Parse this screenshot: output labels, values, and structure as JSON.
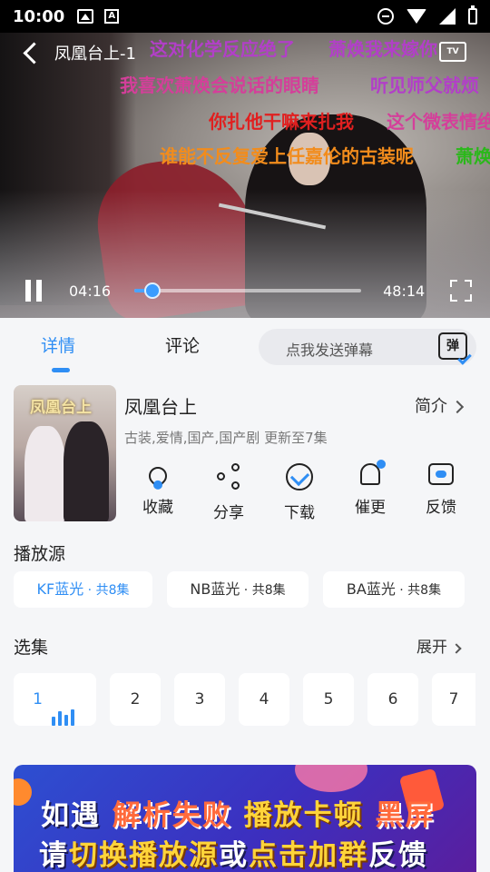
{
  "status_bar": {
    "time": "10:00"
  },
  "player": {
    "title": "凤凰台上-1",
    "current_time": "04:16",
    "duration": "48:14",
    "progress_fraction": 0.08,
    "tv_label": "TV",
    "danmaku": [
      {
        "text": "这对化学反应绝了",
        "color": "#b23fc8"
      },
      {
        "text": "萧焕我来嫁你",
        "color": "#b23fc8"
      },
      {
        "text": "我喜欢萧焕会说话的眼睛",
        "color": "#d43f9a"
      },
      {
        "text": "听见师父就烦",
        "color": "#b23fc8"
      },
      {
        "text": "你扎他干嘛来扎我",
        "color": "#e02020"
      },
      {
        "text": "这个微表情绝",
        "color": "#d43f9a"
      },
      {
        "text": "谁能不反复爱上任嘉伦的古装呢",
        "color": "#f28c1c"
      },
      {
        "text": "萧焕",
        "color": "#2ab81a"
      }
    ]
  },
  "tabs": {
    "details": "详情",
    "comments": "评论"
  },
  "danmu_input": {
    "placeholder": "点我发送弹幕",
    "icon_label": "弹"
  },
  "show": {
    "poster_title": "凤凰台上",
    "title": "凤凰台上",
    "intro_label": "简介",
    "tags": "古装,爱情,国产,国产剧 更新至7集"
  },
  "actions": [
    {
      "label": "收藏",
      "icon": "favorite-heart-icon"
    },
    {
      "label": "分享",
      "icon": "share-icon"
    },
    {
      "label": "下载",
      "icon": "download-icon"
    },
    {
      "label": "催更",
      "icon": "bell-icon"
    },
    {
      "label": "反馈",
      "icon": "feedback-icon"
    }
  ],
  "sources": {
    "heading": "播放源",
    "items": [
      {
        "name": "KF蓝光",
        "count": " · 共8集"
      },
      {
        "name": "NB蓝光",
        "count": " · 共8集"
      },
      {
        "name": "BA蓝光",
        "count": " · 共8集"
      }
    ]
  },
  "episodes": {
    "heading": "选集",
    "expand_label": "展开",
    "items": [
      "1",
      "2",
      "3",
      "4",
      "5",
      "6",
      "7"
    ]
  },
  "banner": {
    "line1": [
      "如遇",
      "解析失败",
      "播放卡顿",
      "黑屏"
    ],
    "line2": [
      "请",
      "切换播放源",
      "或",
      "点击加群",
      "反馈"
    ]
  },
  "colors": {
    "accent": "#2f8ef4"
  }
}
